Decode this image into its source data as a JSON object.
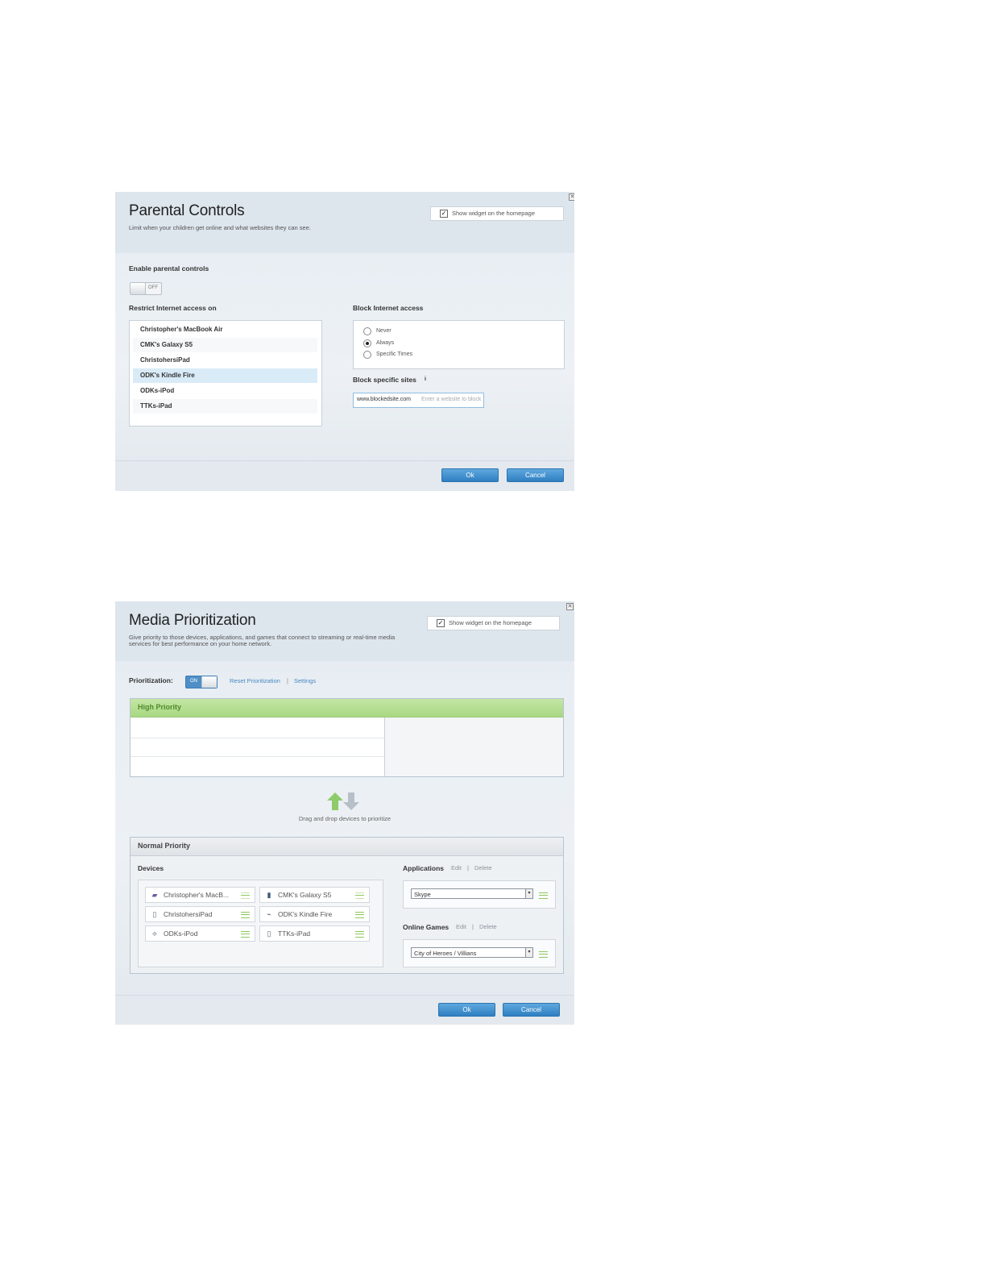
{
  "parental": {
    "title": "Parental Controls",
    "subtitle": "Limit when your children get online and what websites they can see.",
    "widget_label": "Show widget on the homepage",
    "close_glyph": "✕",
    "enable_label": "Enable parental controls",
    "toggle_state": "OFF",
    "restrict_label": "Restrict Internet access on",
    "devices": [
      "Christopher's MacBook Air",
      "CMK's Galaxy S5",
      "ChristohersiPad",
      "ODK's Kindle Fire",
      "ODKs-iPod",
      "TTKs-iPad"
    ],
    "selected_device": "ODK's Kindle Fire",
    "block_label": "Block Internet access",
    "block_options": [
      "Never",
      "Always",
      "Specific Times"
    ],
    "block_selected": "Always",
    "sites_label": "Block specific sites",
    "sites_info": "i",
    "site_value": "www.blockedsite.com",
    "site_placeholder": "Enter a website to block",
    "ok_label": "Ok",
    "cancel_label": "Cancel"
  },
  "media": {
    "title": "Media Prioritization",
    "subtitle_line1": "Give priority to those devices, applications, and games that connect to streaming or real-time media",
    "subtitle_line2": "services for best performance on your home network.",
    "widget_label": "Show widget on the homepage",
    "close_glyph": "✕",
    "prio_label": "Prioritization:",
    "toggle_state": "ON",
    "reset_link": "Reset Prioritization",
    "settings_link": "Settings",
    "link_sep": "|",
    "high_label": "High Priority",
    "drag_hint": "Drag and drop devices to prioritize",
    "normal_label": "Normal Priority",
    "devices_label": "Devices",
    "devices": [
      {
        "name": "Christopher's MacB...",
        "icon": "laptop-icon",
        "glyph": "▰"
      },
      {
        "name": "CMK's Galaxy S5",
        "icon": "phone-icon",
        "glyph": "▮"
      },
      {
        "name": "ChristohersiPad",
        "icon": "tablet-icon",
        "glyph": "▯"
      },
      {
        "name": "ODK's Kindle Fire",
        "icon": "tablet-icon",
        "glyph": "⌁"
      },
      {
        "name": "ODKs-iPod",
        "icon": "network-device-icon",
        "glyph": "⟡"
      },
      {
        "name": "TTKs-iPad",
        "icon": "tablet-icon",
        "glyph": "▯"
      }
    ],
    "apps_label": "Applications",
    "edit_label": "Edit",
    "delete_label": "Delete",
    "app_selected": "Skype",
    "games_label": "Online Games",
    "game_selected": "City of Heroes / Villians",
    "ok_label": "Ok",
    "cancel_label": "Cancel"
  },
  "colors": {
    "accent_blue": "#3a8ccf",
    "high_priority_green": "#a9d883",
    "grip_green": "#8cc85e"
  }
}
